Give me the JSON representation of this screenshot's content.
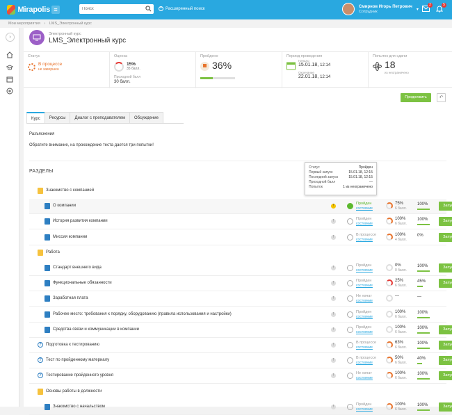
{
  "topbar": {
    "logo": "Mirapolis",
    "search_placeholder": "Поиск",
    "advanced_search": "Расширенный поиск",
    "user_name": "Смирнов Игорь Петрович",
    "user_role": "Сотрудник",
    "mail_count": "2",
    "notif_count": "5"
  },
  "breadcrumb": {
    "root": "Мои мероприятия",
    "sep": "›",
    "current": "LMS_Электронный курс"
  },
  "course": {
    "type": "Электронный курс",
    "title": "LMS_Электронный курс"
  },
  "stats": {
    "status": {
      "label": "Статус",
      "value": "В процессе",
      "sub": "не завершен"
    },
    "score": {
      "label": "Оценка",
      "percent": "15%",
      "points": "35 балл.",
      "pass_label": "Проходной балл",
      "pass_value": "30 балл."
    },
    "passed": {
      "label": "Пройдено",
      "value": "36%",
      "fill": 0.36
    },
    "period": {
      "label": "Период проведения",
      "start_label": "Начало",
      "start": "15.01.18,",
      "start_time": "12:14",
      "end_label": "Окончание",
      "end": "22.01.18,",
      "end_time": "12:14"
    },
    "attempts": {
      "label": "Попыток для сдачи",
      "value": "18",
      "sub": "из неограничено"
    }
  },
  "actions": {
    "continue": "Продолжить"
  },
  "tabs": [
    "Курс",
    "Ресурсы",
    "Диалог с преподавателем",
    "Обсуждение"
  ],
  "explain": {
    "heading": "Разъяснения",
    "text": "Обратите внимание, на прохождение теста дается три попытки!"
  },
  "sections_title": "РАЗДЕЛЫ",
  "tooltip": {
    "rows": [
      [
        "Статус",
        "Пройден"
      ],
      [
        "Первый запуск",
        "15.01.18, 12:15"
      ],
      [
        "Последний запуск",
        "15.01.18, 12:15"
      ],
      [
        "Проходной балл",
        "—"
      ],
      [
        "Попыток",
        "1 из неограничено"
      ]
    ]
  },
  "rows": [
    {
      "type": "folder",
      "indent": 1,
      "name": "Знакомство с компанией"
    },
    {
      "type": "book",
      "indent": 2,
      "name": "О компании",
      "warn": true,
      "ok": true,
      "status": "Пройден",
      "link": "состояние",
      "pct": "75%",
      "pts": "6 балл.",
      "pp": "100%",
      "ppfill": 1,
      "ring": "#e8732c",
      "run": "Запустить",
      "hl": true
    },
    {
      "type": "book",
      "indent": 2,
      "name": "История развития компании",
      "ok": false,
      "status": "Пройден",
      "link": "состояние",
      "pct": "100%",
      "pts": "6 балл.",
      "pp": "100%",
      "ppfill": 1,
      "ring": "#e8732c",
      "run": "Запустить"
    },
    {
      "type": "book",
      "indent": 2,
      "name": "Миссия компании",
      "ok": false,
      "status": "В процессе",
      "link": "состояние",
      "pct": "100%",
      "pts": "4 балл.",
      "pp": "0%",
      "ppfill": 0,
      "ring": "#e8732c",
      "run": "Запустить"
    },
    {
      "type": "folder",
      "indent": 1,
      "name": "Работа"
    },
    {
      "type": "book",
      "indent": 2,
      "name": "Стандарт внешнего вида",
      "ok": false,
      "status": "Пройден",
      "link": "состояние",
      "pct": "0%",
      "pts": "0 балл.",
      "pp": "100%",
      "ppfill": 1,
      "ring": "#ddd",
      "run": "Запустить"
    },
    {
      "type": "book",
      "indent": 2,
      "name": "Функциональные обязанности",
      "ok": false,
      "status": "Пройден",
      "link": "состояние",
      "pct": "25%",
      "pts": "6 балл.",
      "pp": "45%",
      "ppfill": 0.45,
      "ring": "#e53935",
      "run": "Запустить"
    },
    {
      "type": "book",
      "indent": 2,
      "name": "Заработная плата",
      "ok": false,
      "status": "Не начат",
      "link": "состояние",
      "pct": "—",
      "pts": "",
      "pp": "—",
      "ppfill": 0,
      "ring": "#ddd",
      "run": ""
    },
    {
      "type": "book",
      "indent": 2,
      "name": "Рабочее место: требования к порядку, оборудованию (правила использования и настройки)",
      "ok": false,
      "status": "Пройден",
      "link": "состояние",
      "pct": "100%",
      "pts": "6 балл.",
      "pp": "100%",
      "ppfill": 1,
      "ring": "#ddd",
      "run": ""
    },
    {
      "type": "book",
      "indent": 2,
      "name": "Средства связи и коммуникации в компании",
      "ok": false,
      "status": "Пройден",
      "link": "состояние",
      "pct": "100%",
      "pts": "6 балл.",
      "pp": "100%",
      "ppfill": 1,
      "ring": "#ddd",
      "run": "Запустить"
    },
    {
      "type": "test",
      "indent": 1,
      "name": "Подготовка к тестированию",
      "ok": false,
      "status": "В процессе",
      "link": "состояние",
      "pct": "63%",
      "pts": "6 балл.",
      "pp": "100%",
      "ppfill": 1,
      "ring": "#e8732c",
      "run": "Запустить"
    },
    {
      "type": "test",
      "indent": 1,
      "name": "Тест по пройденному материалу",
      "ok": false,
      "status": "В процессе",
      "link": "состояние",
      "pct": "50%",
      "pts": "6 балл.",
      "pp": "40%",
      "ppfill": 0.4,
      "ring": "#e8732c",
      "run": "Запустить"
    },
    {
      "type": "test",
      "indent": 1,
      "name": "Тестирование пройденного уровня",
      "ok": false,
      "status": "Не начат",
      "link": "состояние",
      "pct": "100%",
      "pts": "6 балл.",
      "pp": "100%",
      "ppfill": 1,
      "ring": "#e8732c",
      "run": "Запустить"
    },
    {
      "type": "folder",
      "indent": 1,
      "name": "Основы работы в должности"
    },
    {
      "type": "book",
      "indent": 2,
      "name": "Знакомство с начальством",
      "ok": false,
      "status": "Пройден",
      "link": "состояние",
      "pct": "100%",
      "pts": "6 балл.",
      "pp": "100%",
      "ppfill": 1,
      "ring": "#e8732c",
      "run": "Запустить"
    }
  ],
  "colors": {
    "accent": "#29a8e0",
    "green": "#7cc242",
    "orange": "#e8732c"
  }
}
